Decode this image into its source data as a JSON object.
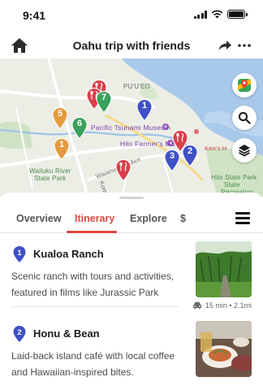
{
  "status": {
    "time": "9:41"
  },
  "header": {
    "title": "Oahu trip with friends"
  },
  "map": {
    "labels": {
      "puueo": "PU'U'EO",
      "tsunami_museum": "Pacific Tsunami Museum",
      "farmers_market": "Hilo Farmer's Market",
      "kens": "Ken's H",
      "wailuku": "Wailuku River",
      "state_park": "State Park",
      "waianuenue": "Waianuenue Ave",
      "komohana": "Komo",
      "hilo_state_park": "Hilo State Park",
      "state": "State",
      "recreation": "Recreation"
    },
    "pins": [
      {
        "kind": "food",
        "color": "#d9404a"
      },
      {
        "kind": "food",
        "color": "#d9404a"
      },
      {
        "kind": "number",
        "label": "7",
        "color": "#3aa05c"
      },
      {
        "kind": "number",
        "label": "1",
        "color": "#3f51c7"
      },
      {
        "kind": "number",
        "label": "6",
        "color": "#3aa05c"
      },
      {
        "kind": "number",
        "label": "5",
        "color": "#e49a3d"
      },
      {
        "kind": "number",
        "label": "1",
        "color": "#e49a3d"
      },
      {
        "kind": "food",
        "color": "#d9404a"
      },
      {
        "kind": "food",
        "color": "#d9404a"
      },
      {
        "kind": "number",
        "label": "3",
        "color": "#3f51c7"
      },
      {
        "kind": "number",
        "label": "2",
        "color": "#3f51c7"
      }
    ]
  },
  "tabs": {
    "overview": "Overview",
    "itinerary": "Itinerary",
    "explore": "Explore",
    "budget": "$"
  },
  "items": [
    {
      "number": "1",
      "title": "Kualoa Ranch",
      "description": "Scenic ranch with tours and activities, featured in films like Jurassic Park",
      "travel": "15 min • 2.1mi"
    },
    {
      "number": "2",
      "title": "Honu & Bean",
      "description": "Laid-back island café with local coffee and Hawaiian-inspired bites."
    }
  ],
  "colors": {
    "accent": "#e0483f",
    "pin_blue": "#3f51c7",
    "pin_green": "#3aa05c",
    "pin_orange": "#e49a3d",
    "pin_red": "#d9404a",
    "water": "#a9c9ea"
  },
  "icons": [
    "home-icon",
    "share-icon",
    "more-icon",
    "maps-app-icon",
    "search-icon",
    "layers-icon",
    "menu-icon",
    "car-icon"
  ]
}
